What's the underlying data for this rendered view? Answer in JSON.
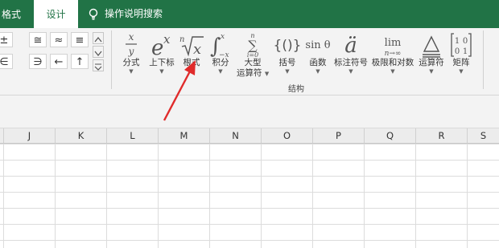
{
  "tabs": {
    "format": "格式",
    "design": "设计",
    "search": "操作说明搜索"
  },
  "symbols": {
    "row1": [
      "±",
      "≅",
      "≈",
      "≡",
      "∀"
    ],
    "row2": [
      "∈",
      "∋",
      "←",
      "↑",
      "∃"
    ]
  },
  "tools": [
    {
      "icon": "fraction-icon",
      "label": "分式"
    },
    {
      "icon": "script-icon",
      "label": "上下标"
    },
    {
      "icon": "radical-icon",
      "label": "根式"
    },
    {
      "icon": "integral-icon",
      "label": "积分"
    },
    {
      "icon": "large-operator-icon",
      "label": "大型",
      "label2": "运算符"
    },
    {
      "icon": "bracket-icon",
      "label": "括号"
    },
    {
      "icon": "function-icon",
      "label": "函数",
      "glyph": "sin θ"
    },
    {
      "icon": "accent-icon",
      "label": "标注符号",
      "glyph": "ä"
    },
    {
      "icon": "limit-icon",
      "label": "极限和对数"
    },
    {
      "icon": "operator-icon",
      "label": "运算符"
    },
    {
      "icon": "matrix-icon",
      "label": "矩阵"
    }
  ],
  "group_label": "结构",
  "columns": [
    "J",
    "K",
    "L",
    "M",
    "N",
    "O",
    "P",
    "Q",
    "R",
    "S"
  ],
  "colors": {
    "accent": "#217346",
    "arrow": "#e02b2b"
  }
}
